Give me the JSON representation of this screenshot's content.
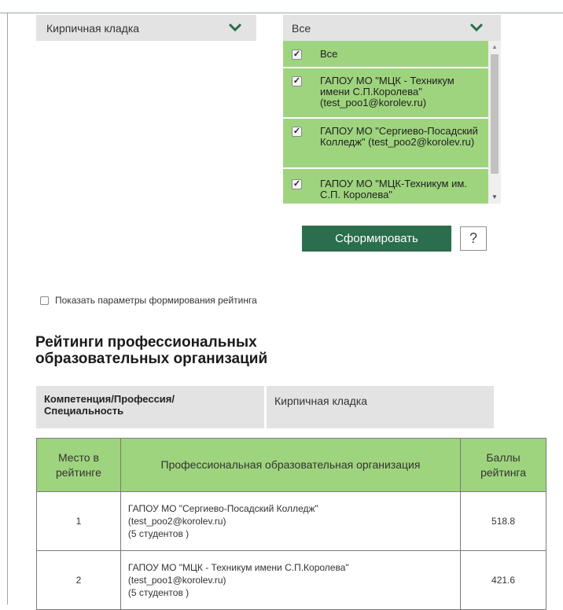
{
  "filters": {
    "competence_selected": "Кирпичная кладка",
    "org_selected": "Все",
    "org_options": [
      {
        "label": "Все",
        "checked": true
      },
      {
        "label": "ГАПОУ МО \"МЦК - Техникум имени С.П.Королева\" (test_poo1@korolev.ru)",
        "checked": true
      },
      {
        "label": "ГАПОУ МО \"Сергиево-Посадский Колледж\" (test_poo2@korolev.ru)",
        "checked": true
      },
      {
        "label": "ГАПОУ МО \"МЦК-Техникум им. С.П. Королева\"",
        "checked": true
      }
    ]
  },
  "actions": {
    "generate_label": "Сформировать",
    "help_label": "?"
  },
  "options": {
    "show_params_label": "Показать параметры формирования рейтинга"
  },
  "heading": {
    "line1": "Рейтинги профессиональных",
    "line2": "образовательных организаций"
  },
  "competence": {
    "label_line1": "Компетенция/Профессия/",
    "label_line2": "Специальность",
    "value": "Кирпичная кладка"
  },
  "rating_table": {
    "headers": {
      "place_line1": "Место в",
      "place_line2": "рейтинге",
      "org": "Профессиональная образовательная организация",
      "score_line1": "Баллы",
      "score_line2": "рейтинга"
    },
    "rows": [
      {
        "place": "1",
        "org_name": "ГАПОУ МО \"Сергиево-Посадский Колледж\"",
        "org_email": "(test_poo2@korolev.ru)",
        "students": "(5 студентов )",
        "score": "518.8"
      },
      {
        "place": "2",
        "org_name": "ГАПОУ МО \"МЦК - Техникум имени С.П.Королева\"",
        "org_email": "(test_poo1@korolev.ru)",
        "students": "(5 студентов )",
        "score": "421.6"
      }
    ]
  },
  "colors": {
    "accent_green": "#9fd47e",
    "button_green": "#2a6e4d",
    "dropdown_gray": "#e3e3e3"
  }
}
